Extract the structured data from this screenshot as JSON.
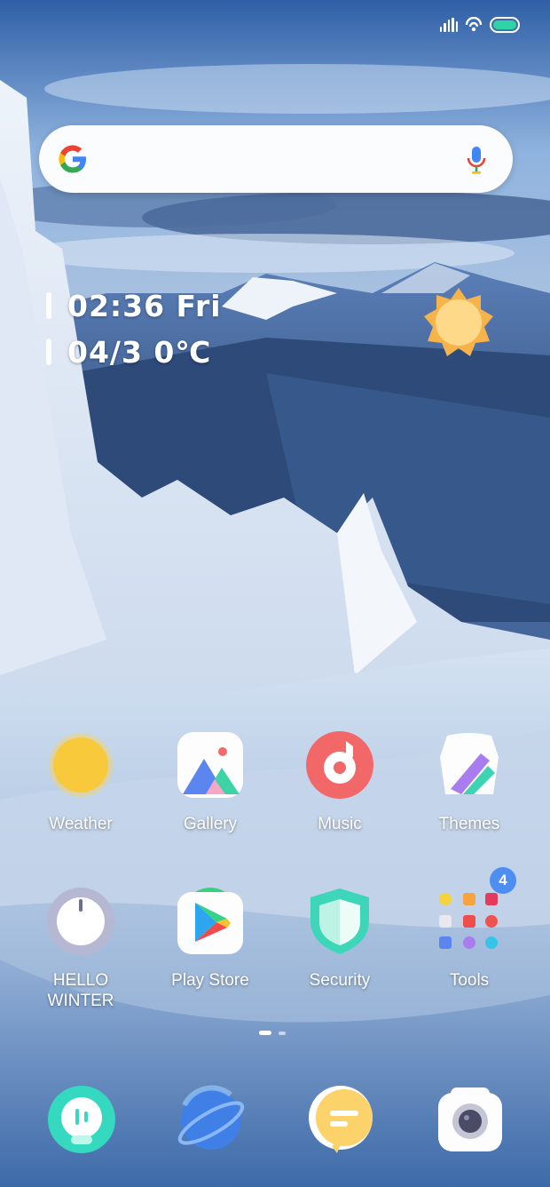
{
  "clock": {
    "time_day": "02:36 Fri",
    "date_temp": "04/3 0℃"
  },
  "apps": [
    {
      "label": "Weather",
      "icon": "weather-sun-icon"
    },
    {
      "label": "Gallery",
      "icon": "gallery-icon"
    },
    {
      "label": "Music",
      "icon": "music-icon"
    },
    {
      "label": "Themes",
      "icon": "themes-icon"
    },
    {
      "label": "HELLO\nWINTER",
      "icon": "hello-winter-icon"
    },
    {
      "label": "Play Store",
      "icon": "play-store-icon"
    },
    {
      "label": "Security",
      "icon": "security-shield-icon"
    },
    {
      "label": "Tools",
      "icon": "tools-folder-icon",
      "badge": "4"
    }
  ],
  "dock": [
    {
      "icon": "phone-icon"
    },
    {
      "icon": "browser-icon"
    },
    {
      "icon": "messaging-icon"
    },
    {
      "icon": "camera-icon"
    }
  ],
  "page_indicator": {
    "pages": 2,
    "current": 1
  },
  "colors": {
    "search_bg": "#fafcfe",
    "badge": "#4d8ef0",
    "battery": "#2fd3a4"
  }
}
